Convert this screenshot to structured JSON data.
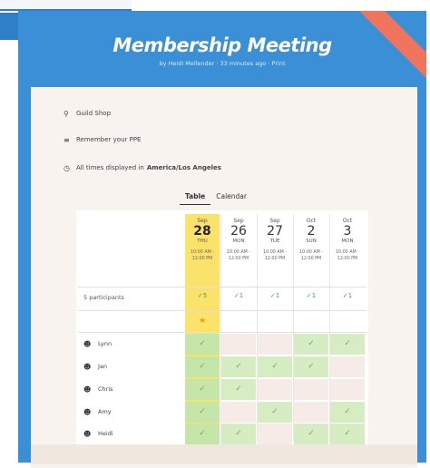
{
  "meeting": {
    "title": "Membership Meeting",
    "subtitle": "by Heidi Mellender · 33 minutes ago · Print",
    "location": "Guild Shop",
    "note": "Remember your PPE",
    "timezone_prefix": "All times displayed in",
    "timezone": "America/Los Angeles"
  },
  "tabs": [
    "Table",
    "Calendar"
  ],
  "active_tab": 0,
  "dates": [
    {
      "mon": "Sep",
      "day": "28",
      "dow": "THU",
      "time1": "10:00 AM -",
      "time2": "12:00 PM",
      "best": true
    },
    {
      "mon": "Sep",
      "day": "26",
      "dow": "MON",
      "time1": "10:00 AM -",
      "time2": "12:00 PM",
      "best": false
    },
    {
      "mon": "Sep",
      "day": "27",
      "dow": "TUE",
      "time1": "10:00 AM -",
      "time2": "12:00 PM",
      "best": false
    },
    {
      "mon": "Oct",
      "day": "2",
      "dow": "SUN",
      "time1": "10:00 AM -",
      "time2": "12:00 PM",
      "best": false
    },
    {
      "mon": "Oct",
      "day": "3",
      "dow": "MON",
      "time1": "10:00 AM -",
      "time2": "12:00 PM",
      "best": false
    }
  ],
  "participants_label": "5 participants",
  "counts": [
    "✓5",
    "✓1",
    "✓1",
    "✓1",
    "✓1"
  ],
  "best_marker": "★",
  "participants": [
    {
      "name": "Lynn",
      "votes": [
        true,
        false,
        false,
        true,
        true
      ]
    },
    {
      "name": "Jan",
      "votes": [
        true,
        true,
        true,
        true,
        false
      ]
    },
    {
      "name": "Chris",
      "votes": [
        true,
        true,
        false,
        false,
        false
      ]
    },
    {
      "name": "Amy",
      "votes": [
        true,
        false,
        true,
        false,
        true
      ]
    },
    {
      "name": "Heidi",
      "votes": [
        true,
        true,
        false,
        true,
        true
      ]
    }
  ],
  "colors": {
    "header_bg": "#3b8fd6",
    "best_bg": "#fbe26b",
    "yes_bg": "#d6ecc3",
    "check": "#6db04a"
  }
}
